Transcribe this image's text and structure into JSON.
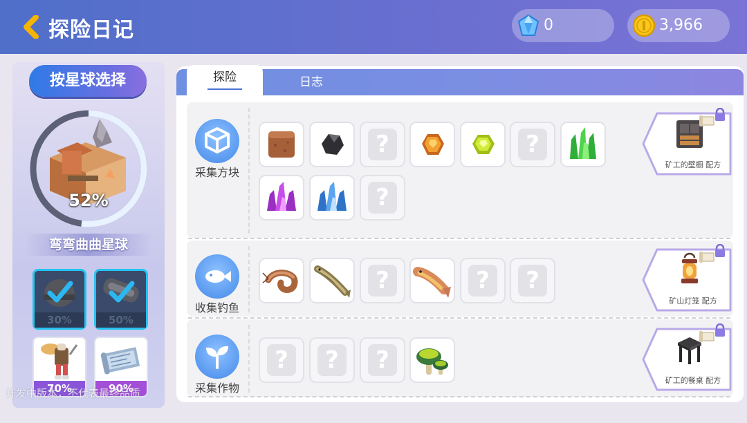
{
  "header": {
    "title": "探险日记",
    "gems": "0",
    "coins": "3,966"
  },
  "left": {
    "planet_button": "按星球选择",
    "planet_percent": "52%",
    "planet_progress": 0.52,
    "planet_name": "弯弯曲曲星球",
    "rewards": [
      {
        "percent": "30%",
        "claimed": true,
        "icon": "helmet-icon"
      },
      {
        "percent": "50%",
        "claimed": true,
        "icon": "conveyor-icon"
      },
      {
        "percent": "70%",
        "claimed": false,
        "icon": "miner-outfit-icon"
      },
      {
        "percent": "90%",
        "claimed": false,
        "icon": "blueprint-icon"
      }
    ],
    "watermark": "开发中版本，不代表最终品质"
  },
  "tabs": {
    "explore": "探险",
    "log": "日志"
  },
  "sections": [
    {
      "label": "采集方块",
      "category_icon": "cube-icon",
      "items": [
        "dirt-block-icon",
        "coal-icon",
        "unknown",
        "amber-ore-icon",
        "green-gem-icon",
        "unknown",
        "green-crystal-icon",
        "purple-crystal-icon",
        "blue-crystal-icon",
        "unknown"
      ],
      "recipe": "矿工的壁橱 配方",
      "recipe_icon": "cabinet-icon"
    },
    {
      "label": "收集钓鱼",
      "category_icon": "fish-icon",
      "items": [
        "shrimp-icon",
        "loach-icon",
        "unknown",
        "trout-icon",
        "unknown",
        "unknown"
      ],
      "recipe": "矿山灯笼 配方",
      "recipe_icon": "lantern-icon"
    },
    {
      "label": "采集作物",
      "category_icon": "sprout-icon",
      "items": [
        "unknown",
        "unknown",
        "unknown",
        "mushroom-icon"
      ],
      "recipe": "矿工的餐桌 配方",
      "recipe_icon": "stool-table-icon"
    }
  ],
  "unknown_mark": "?"
}
